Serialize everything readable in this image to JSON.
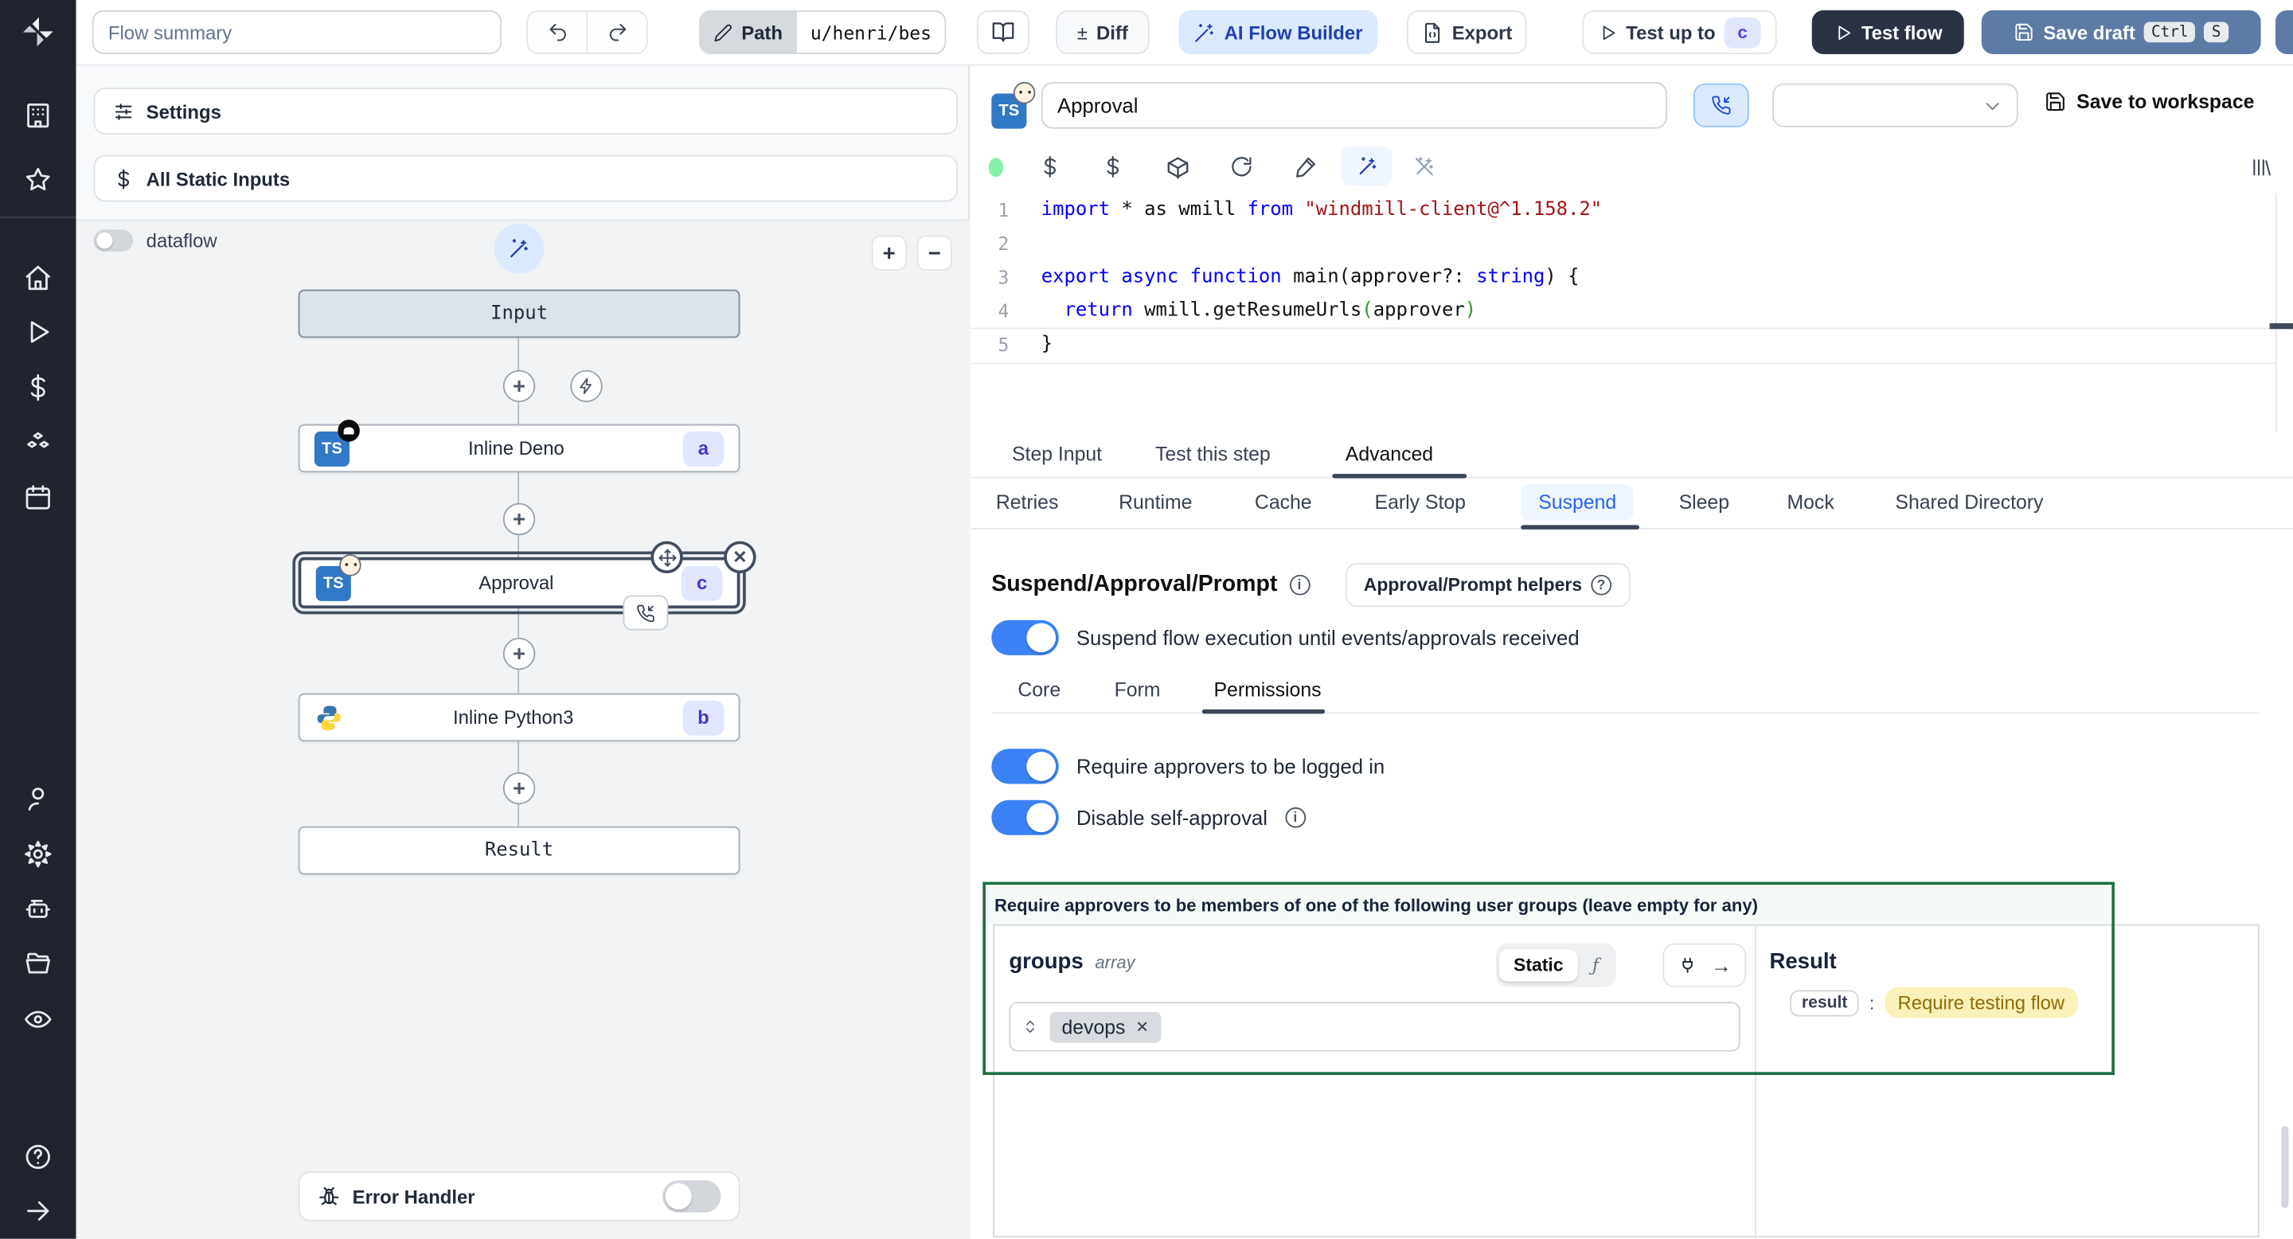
{
  "topbar": {
    "flow_summary_placeholder": "Flow summary",
    "path_label": "Path",
    "path_value": "u/henri/bes",
    "diff_sign": "±",
    "diff_label": "Diff",
    "ai_label": "AI Flow Builder",
    "export_label": "Export",
    "test_up_to_label": "Test up to",
    "test_up_to_badge": "c",
    "test_flow_label": "Test flow",
    "save_draft_label": "Save draft",
    "kbd_ctrl": "Ctrl",
    "kbd_s": "S"
  },
  "sidebar": {
    "icons": [
      "workspace-building",
      "favorites-star",
      "home",
      "runs-play",
      "variables-dollar",
      "resources-cubes",
      "schedules-calendar",
      "user",
      "settings-gear",
      "workers-robot",
      "folders",
      "audit-eye",
      "help",
      "collapse-arrow"
    ]
  },
  "flow": {
    "settings_label": "Settings",
    "static_inputs_label": "All Static Inputs",
    "dataflow_label": "dataflow",
    "zoom_in": "+",
    "zoom_out": "−",
    "nodes": {
      "input_label": "Input",
      "deno_label": "Inline Deno",
      "deno_badge": "a",
      "deno_lang": "TS",
      "approval_label": "Approval",
      "approval_badge": "c",
      "approval_lang": "TS",
      "python_label": "Inline Python3",
      "python_badge": "b",
      "result_label": "Result"
    },
    "plus_glyph": "+",
    "close_glyph": "✕",
    "error_handler_label": "Error Handler"
  },
  "step": {
    "lang": "TS",
    "title_value": "Approval",
    "save_to_workspace": "Save to workspace"
  },
  "editor": {
    "lines": [
      {
        "n": "1",
        "tokens": [
          "import",
          " * as wmill ",
          "from",
          " \"windmill-client@^1.158.2\""
        ]
      },
      {
        "n": "2",
        "tokens": []
      },
      {
        "n": "3",
        "tokens": [
          "export",
          " ",
          "async",
          " ",
          "function",
          " main(approver?:",
          " string",
          ") {"
        ]
      },
      {
        "n": "4",
        "tokens": [
          "  return",
          " wmill.getResumeUrls",
          "(",
          "approver",
          ")"
        ]
      },
      {
        "n": "5",
        "tokens": [
          "}"
        ]
      }
    ]
  },
  "tabs": {
    "primary": [
      {
        "label": "Step Input"
      },
      {
        "label": "Test this step"
      },
      {
        "label": "Advanced",
        "active": true
      }
    ],
    "advanced": [
      {
        "label": "Retries"
      },
      {
        "label": "Runtime"
      },
      {
        "label": "Cache"
      },
      {
        "label": "Early Stop"
      },
      {
        "label": "Suspend",
        "active": true
      },
      {
        "label": "Sleep"
      },
      {
        "label": "Mock"
      },
      {
        "label": "Shared Directory"
      }
    ]
  },
  "suspend": {
    "title": "Suspend/Approval/Prompt",
    "helpers_label": "Approval/Prompt helpers",
    "suspend_toggle_label": "Suspend flow execution until events/approvals received",
    "subtabs": [
      {
        "label": "Core"
      },
      {
        "label": "Form"
      },
      {
        "label": "Permissions",
        "active": true
      }
    ],
    "logged_in_toggle_label": "Require approvers to be logged in",
    "self_approval_toggle_label": "Disable self-approval",
    "groups_box_label": "Require approvers to be members of one of the following user groups (leave empty for any)",
    "groups": {
      "name": "groups",
      "type": "array",
      "static_label": "Static",
      "fx_glyph": "ƒ",
      "arrow_glyph": "→",
      "tag_value": "devops",
      "tag_remove_glyph": "✕"
    },
    "result": {
      "title": "Result",
      "key": "result",
      "colon": ":",
      "value": "Require testing flow"
    }
  },
  "colors": {
    "accent_blue": "#3b82f6",
    "ai_button_bg": "#dbeafe",
    "ai_button_text": "#1e40af",
    "save_draft_bg": "#5d7ba6",
    "test_flow_bg": "#2b3244",
    "badge_bg": "#e0e7ff",
    "badge_text": "#4338ca",
    "suspend_tab_text": "#2563eb",
    "green_box_border": "#1d6f42",
    "result_value_bg": "#fbf1ba",
    "result_value_text": "#926c05",
    "status_dot": "#86efac"
  }
}
